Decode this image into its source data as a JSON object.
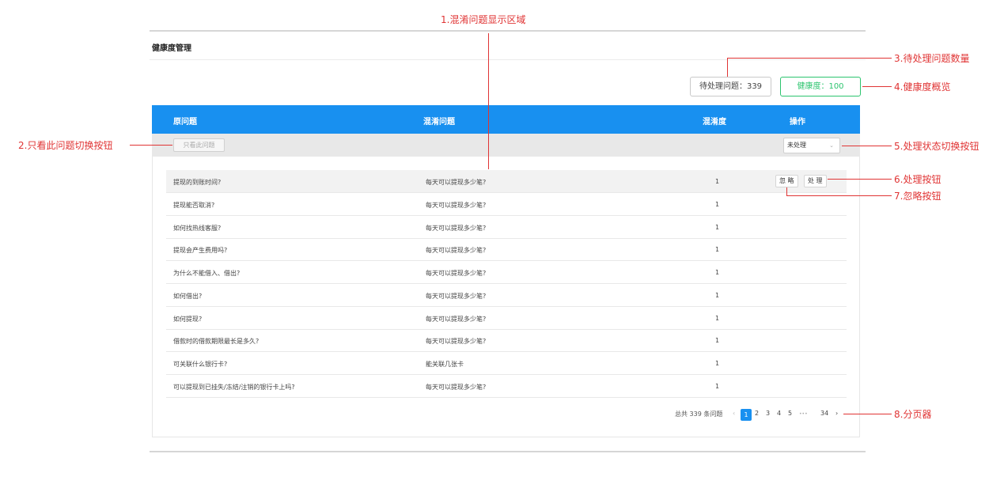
{
  "page": {
    "title": "健康度管理"
  },
  "stats": {
    "pending_label": "待处理问题：339",
    "health_label": "健康度：100"
  },
  "table": {
    "headers": {
      "original": "原问题",
      "confused": "混淆问题",
      "degree": "混淆度",
      "action": "操作"
    },
    "filter": {
      "only_button": "只看此问题",
      "status_selected": "未处理",
      "caret": "⌄"
    },
    "rows": [
      {
        "original": "提现的到账时间?",
        "confused": "每天可以提现多少笔?",
        "degree": "1"
      },
      {
        "original": "提现能否取消?",
        "confused": "每天可以提现多少笔?",
        "degree": "1"
      },
      {
        "original": "如何找热线客服?",
        "confused": "每天可以提现多少笔?",
        "degree": "1"
      },
      {
        "original": "提现会产生费用吗?",
        "confused": "每天可以提现多少笔?",
        "degree": "1"
      },
      {
        "original": "为什么不能借入、借出?",
        "confused": "每天可以提现多少笔?",
        "degree": "1"
      },
      {
        "original": "如何借出?",
        "confused": "每天可以提现多少笔?",
        "degree": "1"
      },
      {
        "original": "如何提现?",
        "confused": "每天可以提现多少笔?",
        "degree": "1"
      },
      {
        "original": "借款时的借款期限最长是多久?",
        "confused": "每天可以提现多少笔?",
        "degree": "1"
      },
      {
        "original": "可关联什么银行卡?",
        "confused": "能关联几张卡",
        "degree": "1"
      },
      {
        "original": "可以提现到已挂失/冻结/注销的银行卡上吗?",
        "confused": "每天可以提现多少笔?",
        "degree": "1"
      }
    ],
    "actions": {
      "ignore": "忽 略",
      "process": "处 理"
    }
  },
  "pagination": {
    "total": "总共 339 条问题",
    "prev": "‹",
    "pages": [
      "1",
      "2",
      "3",
      "4",
      "5"
    ],
    "ellipsis": "•••",
    "last": "34",
    "next": "›",
    "current": "1"
  },
  "annotations": {
    "a1": "1.混淆问题显示区域",
    "a2": "2.只看此问题切换按钮",
    "a3": "3.待处理问题数量",
    "a4": "4.健康度概览",
    "a5": "5.处理状态切换按钮",
    "a6": "6.处理按钮",
    "a7": "7.忽略按钮",
    "a8": "8.分页器"
  },
  "colors": {
    "accent": "#1890f0",
    "health": "#2cc46e",
    "annotation": "#e03434"
  }
}
